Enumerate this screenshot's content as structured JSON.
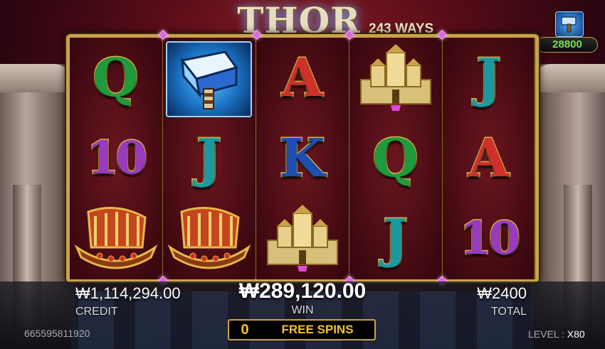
{
  "game": {
    "title": "THOR",
    "ways": "243 WAYS",
    "scatter_badge_value": "28800"
  },
  "reels": [
    [
      {
        "symbol": "Q",
        "color": "#1f9a3c",
        "icon": "letter-q"
      },
      {
        "symbol": "10",
        "color": "#9a3ac0",
        "icon": "number-10"
      },
      {
        "symbol": "ship",
        "icon": "viking-ship-icon"
      }
    ],
    [
      {
        "symbol": "hammer",
        "icon": "hammer-icon",
        "highlighted": true
      },
      {
        "symbol": "J",
        "color": "#1a9aa0",
        "icon": "letter-j"
      },
      {
        "symbol": "ship",
        "icon": "viking-ship-icon"
      }
    ],
    [
      {
        "symbol": "A",
        "color": "#d0302a",
        "icon": "letter-a"
      },
      {
        "symbol": "K",
        "color": "#1d4fb0",
        "icon": "letter-k"
      },
      {
        "symbol": "castle",
        "icon": "castle-icon"
      }
    ],
    [
      {
        "symbol": "castle",
        "icon": "castle-icon"
      },
      {
        "symbol": "Q",
        "color": "#1f9a3c",
        "icon": "letter-q"
      },
      {
        "symbol": "J",
        "color": "#1a9aa0",
        "icon": "letter-j"
      }
    ],
    [
      {
        "symbol": "J",
        "color": "#1a9aa0",
        "icon": "letter-j"
      },
      {
        "symbol": "A",
        "color": "#d0302a",
        "icon": "letter-a"
      },
      {
        "symbol": "10",
        "color": "#9a3ac0",
        "icon": "number-10"
      }
    ]
  ],
  "panel": {
    "credit_value": "₩1,114,294.00",
    "credit_label": "CREDIT",
    "win_value": "₩289,120.00",
    "win_label": "WIN",
    "total_value": "₩2400",
    "total_label": "TOTAL",
    "free_spins_count": "0",
    "free_spins_label": "FREE SPINS",
    "bet_id": "665595811920",
    "level_label": "LEVEL : ",
    "level_value": "X80"
  },
  "colors": {
    "frame_gold": "#c9a24a",
    "win_text": "#ffffff",
    "free_spins_text": "#f2c230",
    "scatter_value_text": "#7ae05a"
  }
}
